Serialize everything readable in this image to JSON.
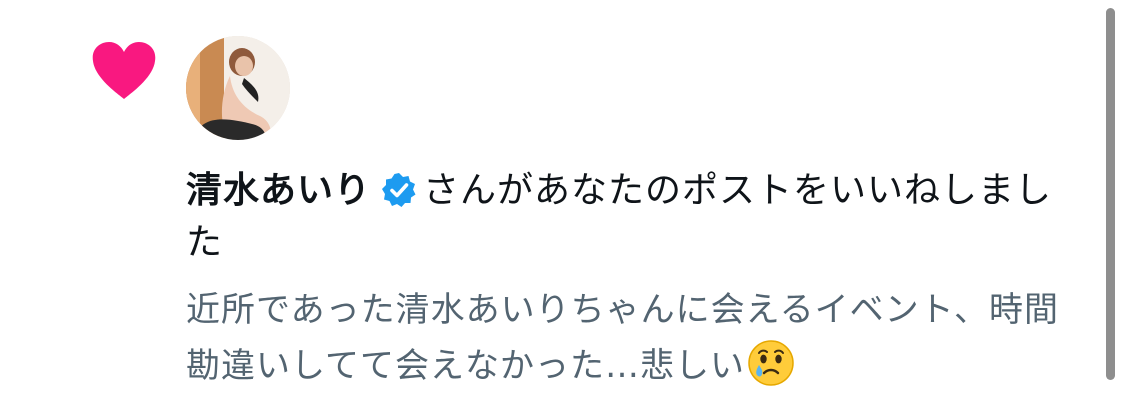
{
  "notification": {
    "type_icon": "heart-icon",
    "avatar_icon": "avatar",
    "user_name": "清水あいり",
    "verified_icon": "verified-badge-icon",
    "action_text": "さんがあなたのポストをいいねしました",
    "post_text": "近所であった清水あいりちゃんに会えるイベント、時間勘違いしてて会えなかった…悲しい",
    "post_emoji": "face-holding-back-tears-emoji"
  },
  "colors": {
    "heart": "#f91880",
    "verified": "#1d9bf0",
    "primary_text": "#0f1419",
    "secondary_text": "#536471",
    "scrollbar": "#8e8e8e"
  }
}
